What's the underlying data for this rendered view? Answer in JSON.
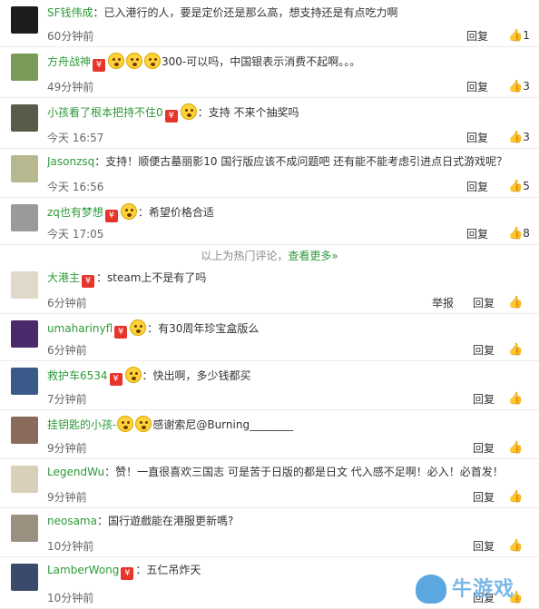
{
  "comments": [
    {
      "user": "SF钱伟成",
      "text": "：已入港行的人，要是定价还是那么高，想支持还是有点吃力啊",
      "time": "60分钟前",
      "reply": "回复",
      "likes": "1",
      "hb": false,
      "emojis": 0,
      "avatar_color": "#1c1c1c"
    },
    {
      "user": "方舟战神",
      "text": "300-可以吗，中国银表示消费不起啊。。。",
      "time": "49分钟前",
      "reply": "回复",
      "likes": "3",
      "hb": true,
      "emojis": 3,
      "avatar_color": "#7a9a58"
    },
    {
      "user": "小孩看了根本把持不住0",
      "text": "：支持 不来个抽奖吗",
      "time": "今天 16:57",
      "reply": "回复",
      "likes": "3",
      "hb": true,
      "emojis": 1,
      "avatar_color": "#5a5a4a"
    },
    {
      "user": "Jasonzsq",
      "text": "：支持！顺便古墓丽影10 国行版应该不成问题吧 还有能不能考虑引进点日式游戏呢？",
      "time": "今天 16:56",
      "reply": "回复",
      "likes": "5",
      "hb": false,
      "emojis": 0,
      "avatar_color": "#b8b890"
    },
    {
      "user": "zq也有梦想",
      "text": "：希望价格合适",
      "time": "今天 17:05",
      "reply": "回复",
      "likes": "8",
      "hb": true,
      "emojis": 1,
      "avatar_color": "#9a9a9a"
    },
    {
      "user": "大港主",
      "text": "：steam上不是有了吗",
      "time": "6分钟前",
      "report": "举报",
      "reply": "回复",
      "likes": "",
      "hb": true,
      "emojis": 0,
      "avatar_color": "#e0d8c8"
    },
    {
      "user": "umaharinyfl",
      "text": "：有30周年珍宝盒版么",
      "time": "6分钟前",
      "reply": "回复",
      "likes": "",
      "hb": true,
      "emojis": 1,
      "avatar_color": "#4a2a6a"
    },
    {
      "user": "救护车6534",
      "text": "：快出啊，多少钱都买",
      "time": "7分钟前",
      "reply": "回复",
      "likes": "",
      "hb": true,
      "emojis": 1,
      "avatar_color": "#3a5a8a"
    },
    {
      "user": "挂钥匙的小孩-",
      "text": "感谢索尼@Burning________",
      "time": "9分钟前",
      "reply": "回复",
      "likes": "",
      "hb": false,
      "emojis": 2,
      "avatar_color": "#8a6a5a"
    },
    {
      "user": "LegendWu",
      "text": "：赞！一直很喜欢三国志 可是苦于日版的都是日文 代入感不足啊！必入！必首发！",
      "time": "9分钟前",
      "reply": "回复",
      "likes": "",
      "hb": false,
      "emojis": 0,
      "avatar_color": "#d8d0b8"
    },
    {
      "user": "neosama",
      "text": "：国行遊戲能在港服更新嗎?",
      "time": "10分钟前",
      "reply": "回复",
      "likes": "",
      "hb": false,
      "emojis": 0,
      "avatar_color": "#9a9080"
    },
    {
      "user": "LamberWong",
      "text": "：五仁吊炸天",
      "time": "10分钟前",
      "reply": "回复",
      "likes": "",
      "hb": true,
      "emojis": 0,
      "avatar_color": "#3a4a6a"
    }
  ],
  "divider": {
    "text": "以上为热门评论，",
    "more": "查看更多»"
  },
  "watermark": {
    "text": "牛游戏"
  },
  "icons": {
    "thumb": "thumbs-up-icon",
    "hongbao": "red-envelope-icon"
  }
}
